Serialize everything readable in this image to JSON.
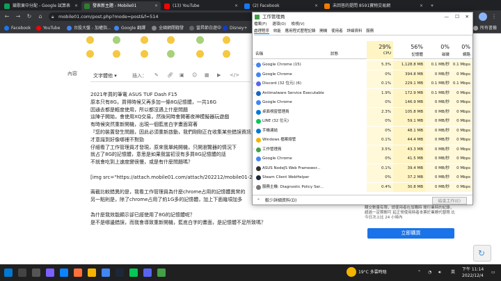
{
  "browser": {
    "tabs": [
      {
        "label": "競歌東中分配 - Google 試算表",
        "color": "#0f9d58"
      },
      {
        "label": "發表新主題 - Mobile01",
        "color": "#2e7d32"
      },
      {
        "label": "(13) YouTube",
        "color": "#ff0000"
      },
      {
        "label": "(2) Facebook",
        "color": "#1877f2"
      },
      {
        "label": "未回答的提問 8591寶物交易網",
        "color": "#f57c00"
      }
    ],
    "url": "mobile01.com/post.php?mode=post&f=514",
    "bookmarks": [
      {
        "label": "Facebook",
        "color": "#1877f2"
      },
      {
        "label": "YouTube",
        "color": "#ff0000"
      },
      {
        "label": "台股大盤 - 加權指...",
        "color": "#4285f4"
      },
      {
        "label": "Google 翻譯",
        "color": "#4285f4"
      },
      {
        "label": "全國網開戰發",
        "color": "#888888"
      },
      {
        "label": "當昇節白遊中",
        "color": "#666666"
      },
      {
        "label": "Disney+",
        "color": "#113ccf"
      },
      {
        "label": "所有書籤",
        "color": "#aaaaaa"
      }
    ]
  },
  "editor": {
    "label": "內容",
    "style_select": "文字體他",
    "insert_label": "插入："
  },
  "post": {
    "lines": [
      "2021年買的筆電 ASUS TUF Dash F15",
      "原本只有8G，買得時候又再多加一條8G記憶體，一共16G",
      "因通去都是輕度使用，所以都沒遇上什麼問題",
      "這陣子開始，會使用XQ交易，然後同時會開著夜神模擬器玩遊戲",
      "有時候突然重新開機，出現一個藍底白字畫面寫著",
      "『您的裝置發生問題，因此必須重新啟動，我們剛剛正在收集某些錯誤資訊，接著',",
      "才意識到好像哪裡不對勁",
      "仔細看了工作管理員才發現，原來我單純開機，只開瀏覽器的情況下",
      "就占了8G的記憶體，意思是如果我當初沒有多買8G記憶體的話",
      "不就會吃到上速度變很慢，或是有什麼問題嗎？",
      "",
      "[img src=\"https://attach.mobile01.com/attach/202212/mobile01-234c7e",
      "",
      "兩截比較錯異的是，我看工作管理員為什麼chrome占用的記憶體異常的",
      "另一點則是，除了chrome占用了約1G多的記憶體，加上下面幾項加多",
      "",
      "為什麼我效能顯示卻已經使用了8G的記憶體呢？",
      "是不是哪邊錯誤，而我會導致重新開機，藍底白字的畫面，是記憶體不足所致嗎？"
    ]
  },
  "sidebar": {
    "ad_text": "購交數量有限，請使用者在加購時 間行業時的紀錄，超過一定期間可 延正常使用時者本票於業務代替限 比今日次上比 24 小時內",
    "buy_label": "立即購買"
  },
  "taskmgr": {
    "title": "工作管理員",
    "menu": [
      "檔案(F)",
      "選項(O)",
      "檢視(V)"
    ],
    "tabs": [
      "處理程序",
      "效能",
      "應用程式歷程記錄",
      "開機",
      "使用者",
      "詳細資料",
      "服務"
    ],
    "headers": {
      "name": "名稱",
      "status": "狀態",
      "cpu_pct": "29%",
      "cpu": "CPU",
      "mem_pct": "56%",
      "mem": "記憶體",
      "disk_pct": "0%",
      "disk": "磁碟",
      "net_pct": "0%",
      "net": "網路"
    },
    "processes": [
      {
        "name": "Google Chrome (15)",
        "cpu": "5.3%",
        "mem": "1,128.8 MB",
        "disk": "0.1 MB/秒",
        "net": "0.1 Mbps",
        "icon": "#4285f4",
        "expand": true
      },
      {
        "name": "Google Chrome",
        "cpu": "0%",
        "mem": "394.8 MB",
        "disk": "0 MB/秒",
        "net": "0 Mbps",
        "icon": "#4285f4",
        "expand": false
      },
      {
        "name": "Discord (32 位元) (6)",
        "cpu": "0.1%",
        "mem": "229.1 MB",
        "disk": "0.1 MB/秒",
        "net": "0.1 Mbps",
        "icon": "#5865f2",
        "expand": true
      },
      {
        "name": "Antimalware Service Executable",
        "cpu": "1.9%",
        "mem": "172.9 MB",
        "disk": "0.1 MB/秒",
        "net": "0 Mbps",
        "icon": "#1565c0",
        "expand": true
      },
      {
        "name": "Google Chrome",
        "cpu": "0%",
        "mem": "146.9 MB",
        "disk": "0 MB/秒",
        "net": "0 Mbps",
        "icon": "#4285f4",
        "expand": false
      },
      {
        "name": "桌面視窗管理員",
        "cpu": "2.3%",
        "mem": "105.8 MB",
        "disk": "0 MB/秒",
        "net": "0 Mbps",
        "icon": "#0078d4",
        "expand": false
      },
      {
        "name": "LINE (32 位元)",
        "cpu": "0%",
        "mem": "59.1 MB",
        "disk": "0 MB/秒",
        "net": "0 Mbps",
        "icon": "#06c755",
        "expand": false
      },
      {
        "name": "手機連結",
        "cpu": "0%",
        "mem": "48.1 MB",
        "disk": "0 MB/秒",
        "net": "0 Mbps",
        "icon": "#0078d4",
        "expand": true
      },
      {
        "name": "Windows 檔案總管",
        "cpu": "0.1%",
        "mem": "44.4 MB",
        "disk": "0 MB/秒",
        "net": "0 Mbps",
        "icon": "#f4b400",
        "expand": false
      },
      {
        "name": "工作管理員",
        "cpu": "3.5%",
        "mem": "43.3 MB",
        "disk": "0 MB/秒",
        "net": "0 Mbps",
        "icon": "#43a047",
        "expand": true
      },
      {
        "name": "Google Chrome",
        "cpu": "0%",
        "mem": "41.5 MB",
        "disk": "0 MB/秒",
        "net": "0 Mbps",
        "icon": "#4285f4",
        "expand": false
      },
      {
        "name": "ASUS NodeJS Web Framewor...",
        "cpu": "0.1%",
        "mem": "39.4 MB",
        "disk": "0 MB/秒",
        "net": "0 Mbps",
        "icon": "#333333",
        "expand": false
      },
      {
        "name": "Steam Client WebHelper",
        "cpu": "0%",
        "mem": "37.2 MB",
        "disk": "0 MB/秒",
        "net": "0 Mbps",
        "icon": "#1b2838",
        "expand": false
      },
      {
        "name": "服務主機: Diagnostic Policy Ser...",
        "cpu": "0.4%",
        "mem": "30.8 MB",
        "disk": "0 MB/秒",
        "net": "0 Mbps",
        "icon": "#777777",
        "expand": true
      }
    ],
    "less_details": "較少詳細資料(D)",
    "end_task": "結束工作(E)"
  },
  "taskbar": {
    "weather": "19°C 多雲時陰",
    "lang": "英",
    "time": "下午 11:14",
    "date": "2022/12/4"
  }
}
